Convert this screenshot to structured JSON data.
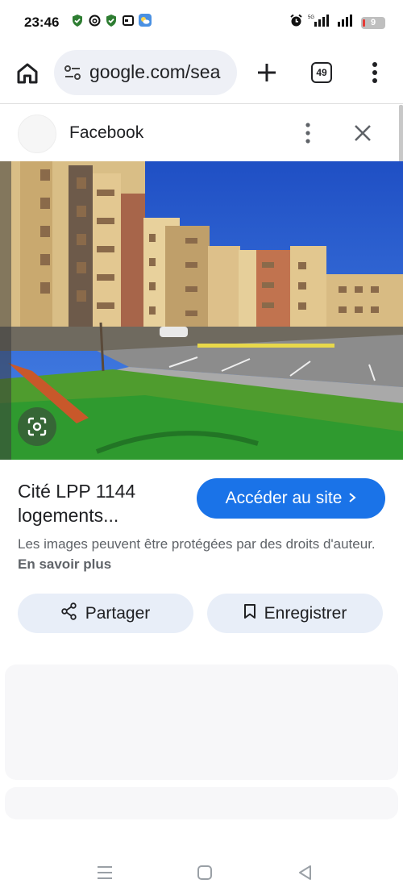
{
  "status_bar": {
    "time": "23:46",
    "battery_level": "9",
    "icons": [
      "shield-icon",
      "threads-icon",
      "shield-icon",
      "calendar-icon",
      "weather-icon",
      "alarm-icon",
      "signal-icon",
      "signal-icon"
    ]
  },
  "browser": {
    "url": "google.com/sea",
    "tab_count": "49"
  },
  "panel": {
    "source_name": "Facebook",
    "title": "Cité LPP 1144 logements...",
    "visit_button": "Accéder au site",
    "copyright_text": "Les images peuvent être protégées par des droits d'auteur.",
    "learn_more": "En savoir plus",
    "share_button": "Partager",
    "save_button": "Enregistrer"
  },
  "colors": {
    "accent": "#1a73e8",
    "chip_bg": "#e8eef8",
    "url_bg": "#eef0f6"
  }
}
